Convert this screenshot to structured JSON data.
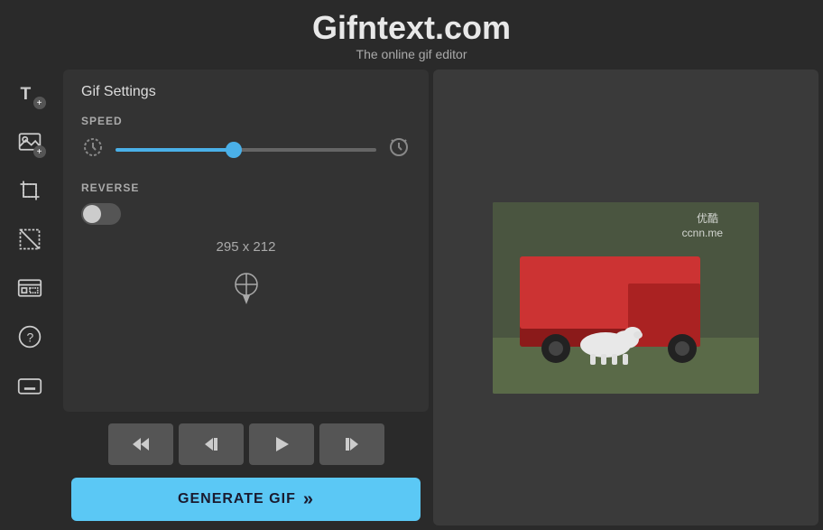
{
  "header": {
    "title": "Gifntext.com",
    "subtitle": "The online gif editor"
  },
  "toolbar": {
    "items": [
      {
        "name": "add-text",
        "label": "T",
        "has_plus": true
      },
      {
        "name": "add-image",
        "label": "IMG",
        "has_plus": true
      },
      {
        "name": "crop",
        "label": "CROP",
        "has_plus": false
      },
      {
        "name": "cut",
        "label": "CUT",
        "has_plus": false
      },
      {
        "name": "gif-image",
        "label": "GIMG",
        "has_plus": false
      },
      {
        "name": "help",
        "label": "?",
        "has_plus": false
      },
      {
        "name": "keyboard",
        "label": "KB",
        "has_plus": false
      }
    ]
  },
  "settings": {
    "title": "Gif Settings",
    "speed_label": "SPEED",
    "speed_value": 45,
    "reverse_label": "REVERSE",
    "reverse_enabled": false,
    "dimensions": "295 x 212"
  },
  "playback": {
    "rewind_label": "⏪",
    "prev_label": "⏮",
    "play_label": "▶",
    "next_label": "⏭"
  },
  "generate": {
    "label": "GENERATE GIF",
    "chevrons": "»"
  },
  "preview": {
    "watermark1": "优酷",
    "watermark2": "ccnn.me"
  }
}
